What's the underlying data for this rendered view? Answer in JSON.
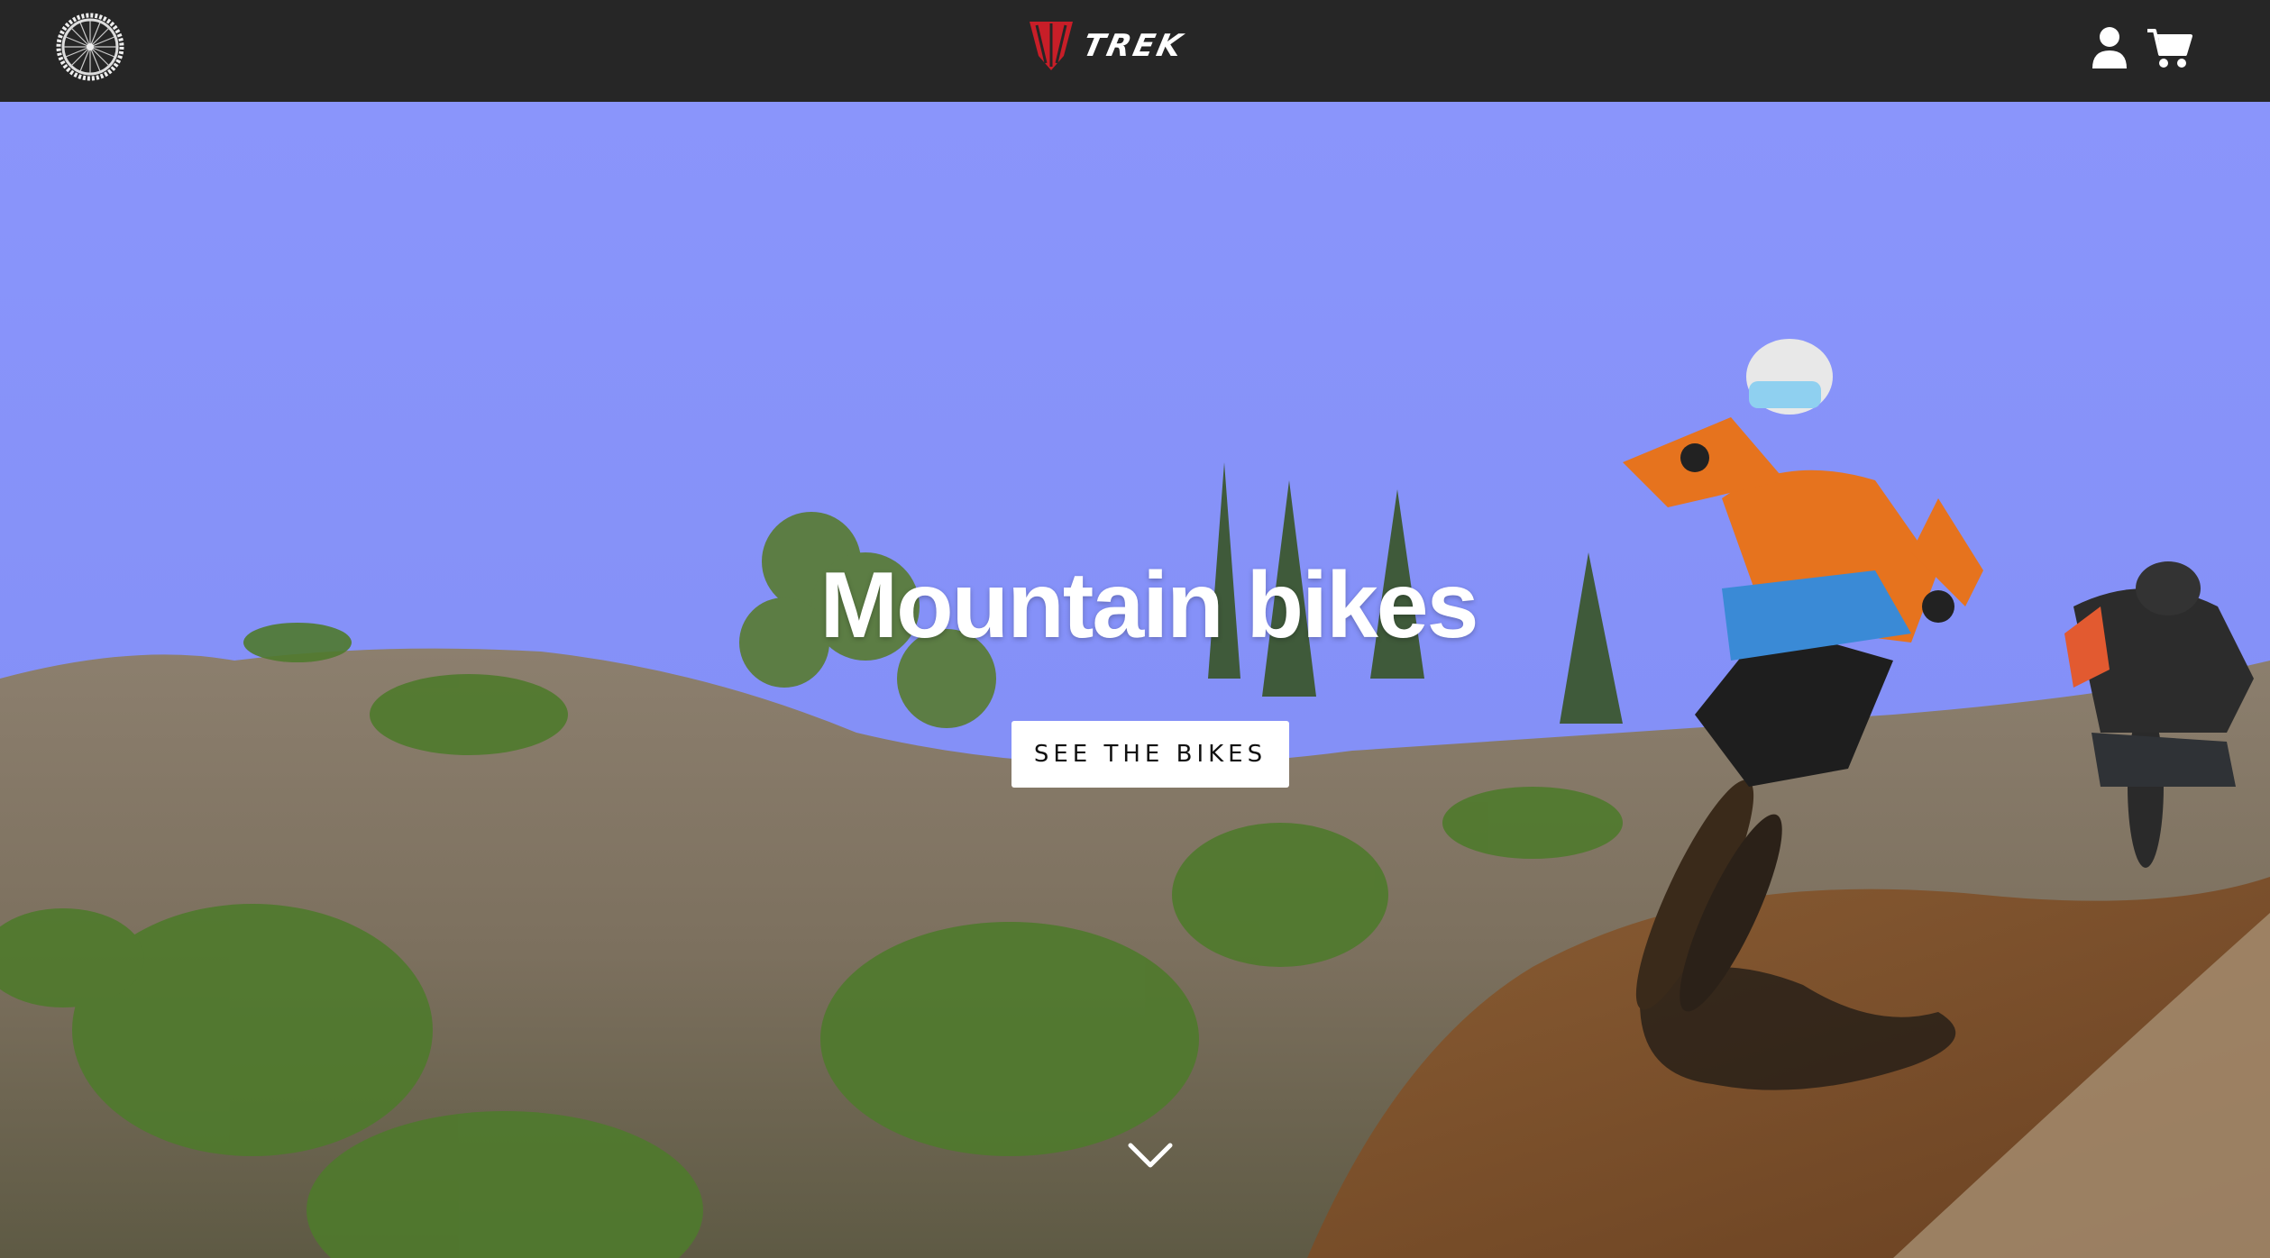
{
  "header": {
    "brand_name": "TREK",
    "icons": {
      "menu": "bike-wheel-icon",
      "logo": "trek-shield-icon",
      "account": "user-icon",
      "cart": "shopping-cart-icon"
    },
    "colors": {
      "bar": "#262626",
      "brand_red": "#d0202a",
      "icon": "#ffffff"
    }
  },
  "hero": {
    "title": "Mountain bikes",
    "cta_label": "SEE THE BIKES",
    "scroll_icon": "chevron-down-icon",
    "background": "mountain-biker-video-still"
  }
}
